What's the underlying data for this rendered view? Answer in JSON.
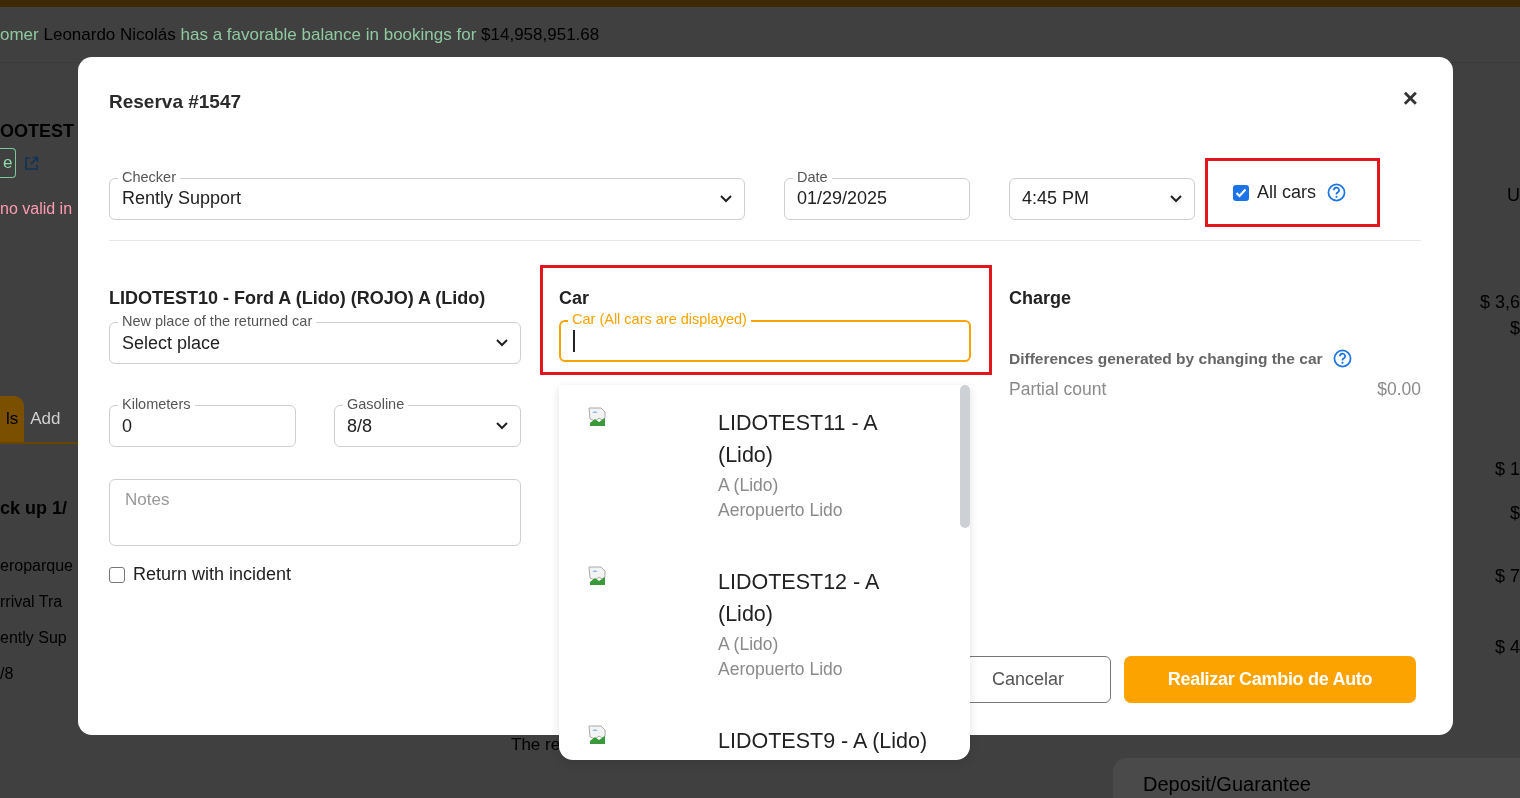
{
  "background": {
    "banner": "omer **Leonardo Nicolás** has a favorable balance in bookings for **$14,958,951.68**",
    "left_items": [
      {
        "kind": "heading",
        "text": "OOTEST"
      },
      {
        "kind": "badge",
        "text": "e"
      },
      {
        "kind": "error",
        "text": "no valid in"
      },
      {
        "kind": "tabs",
        "tabs": [
          {
            "label": "ls",
            "selected": true
          },
          {
            "label": "Add",
            "selected": false
          }
        ]
      },
      {
        "kind": "heading",
        "text": "ck up 1/"
      },
      {
        "kind": "text",
        "text": "eroparque"
      },
      {
        "kind": "text",
        "text": "rrival Tra"
      },
      {
        "kind": "text",
        "text": "ently Sup"
      },
      {
        "kind": "text",
        "text": "/8"
      }
    ],
    "right_items": [
      "U",
      "$ 3,6",
      "$",
      "$ 1",
      "$",
      "$ 7",
      "$ 4"
    ],
    "footer_left": "The re",
    "footer_card": "Deposit/Guarantee"
  },
  "modal": {
    "title": "Reserva #1547",
    "close": "×",
    "checker": {
      "label": "Checker",
      "value": "Rently Support"
    },
    "date": {
      "label": "Date",
      "value": "01/29/2025"
    },
    "time": {
      "value": "4:45 PM"
    },
    "all_cars": {
      "label": "All cars",
      "checked": true,
      "highlighted": true
    },
    "returned_car": {
      "title": "LIDOTEST10 - Ford A (Lido) (ROJO) A (Lido)",
      "place": {
        "label": "New place of the returned car",
        "value": "Select place"
      },
      "kilometers": {
        "label": "Kilometers",
        "value": "0"
      },
      "gasoline": {
        "label": "Gasoline",
        "value": "8/8"
      },
      "notes": {
        "placeholder": "Notes"
      },
      "incident": {
        "label": "Return with incident",
        "checked": false
      }
    },
    "car": {
      "title": "Car",
      "highlighted": true,
      "field": {
        "label": "Car (All cars are displayed)",
        "focused": true
      },
      "options": [
        {
          "name": "LIDOTEST11 - A (Lido)",
          "category": "A (Lido)",
          "location": "Aeropuerto Lido"
        },
        {
          "name": "LIDOTEST12 - A (Lido)",
          "category": "A (Lido)",
          "location": "Aeropuerto Lido"
        },
        {
          "name": "LIDOTEST9 - A (Lido)"
        }
      ]
    },
    "charge": {
      "title": "Charge",
      "differences": "Differences generated by changing the car",
      "partial": {
        "label": "Partial count",
        "value": "$0.00"
      }
    },
    "buttons": {
      "cancel": "Cancelar",
      "submit": "Realizar Cambio de Auto"
    }
  }
}
